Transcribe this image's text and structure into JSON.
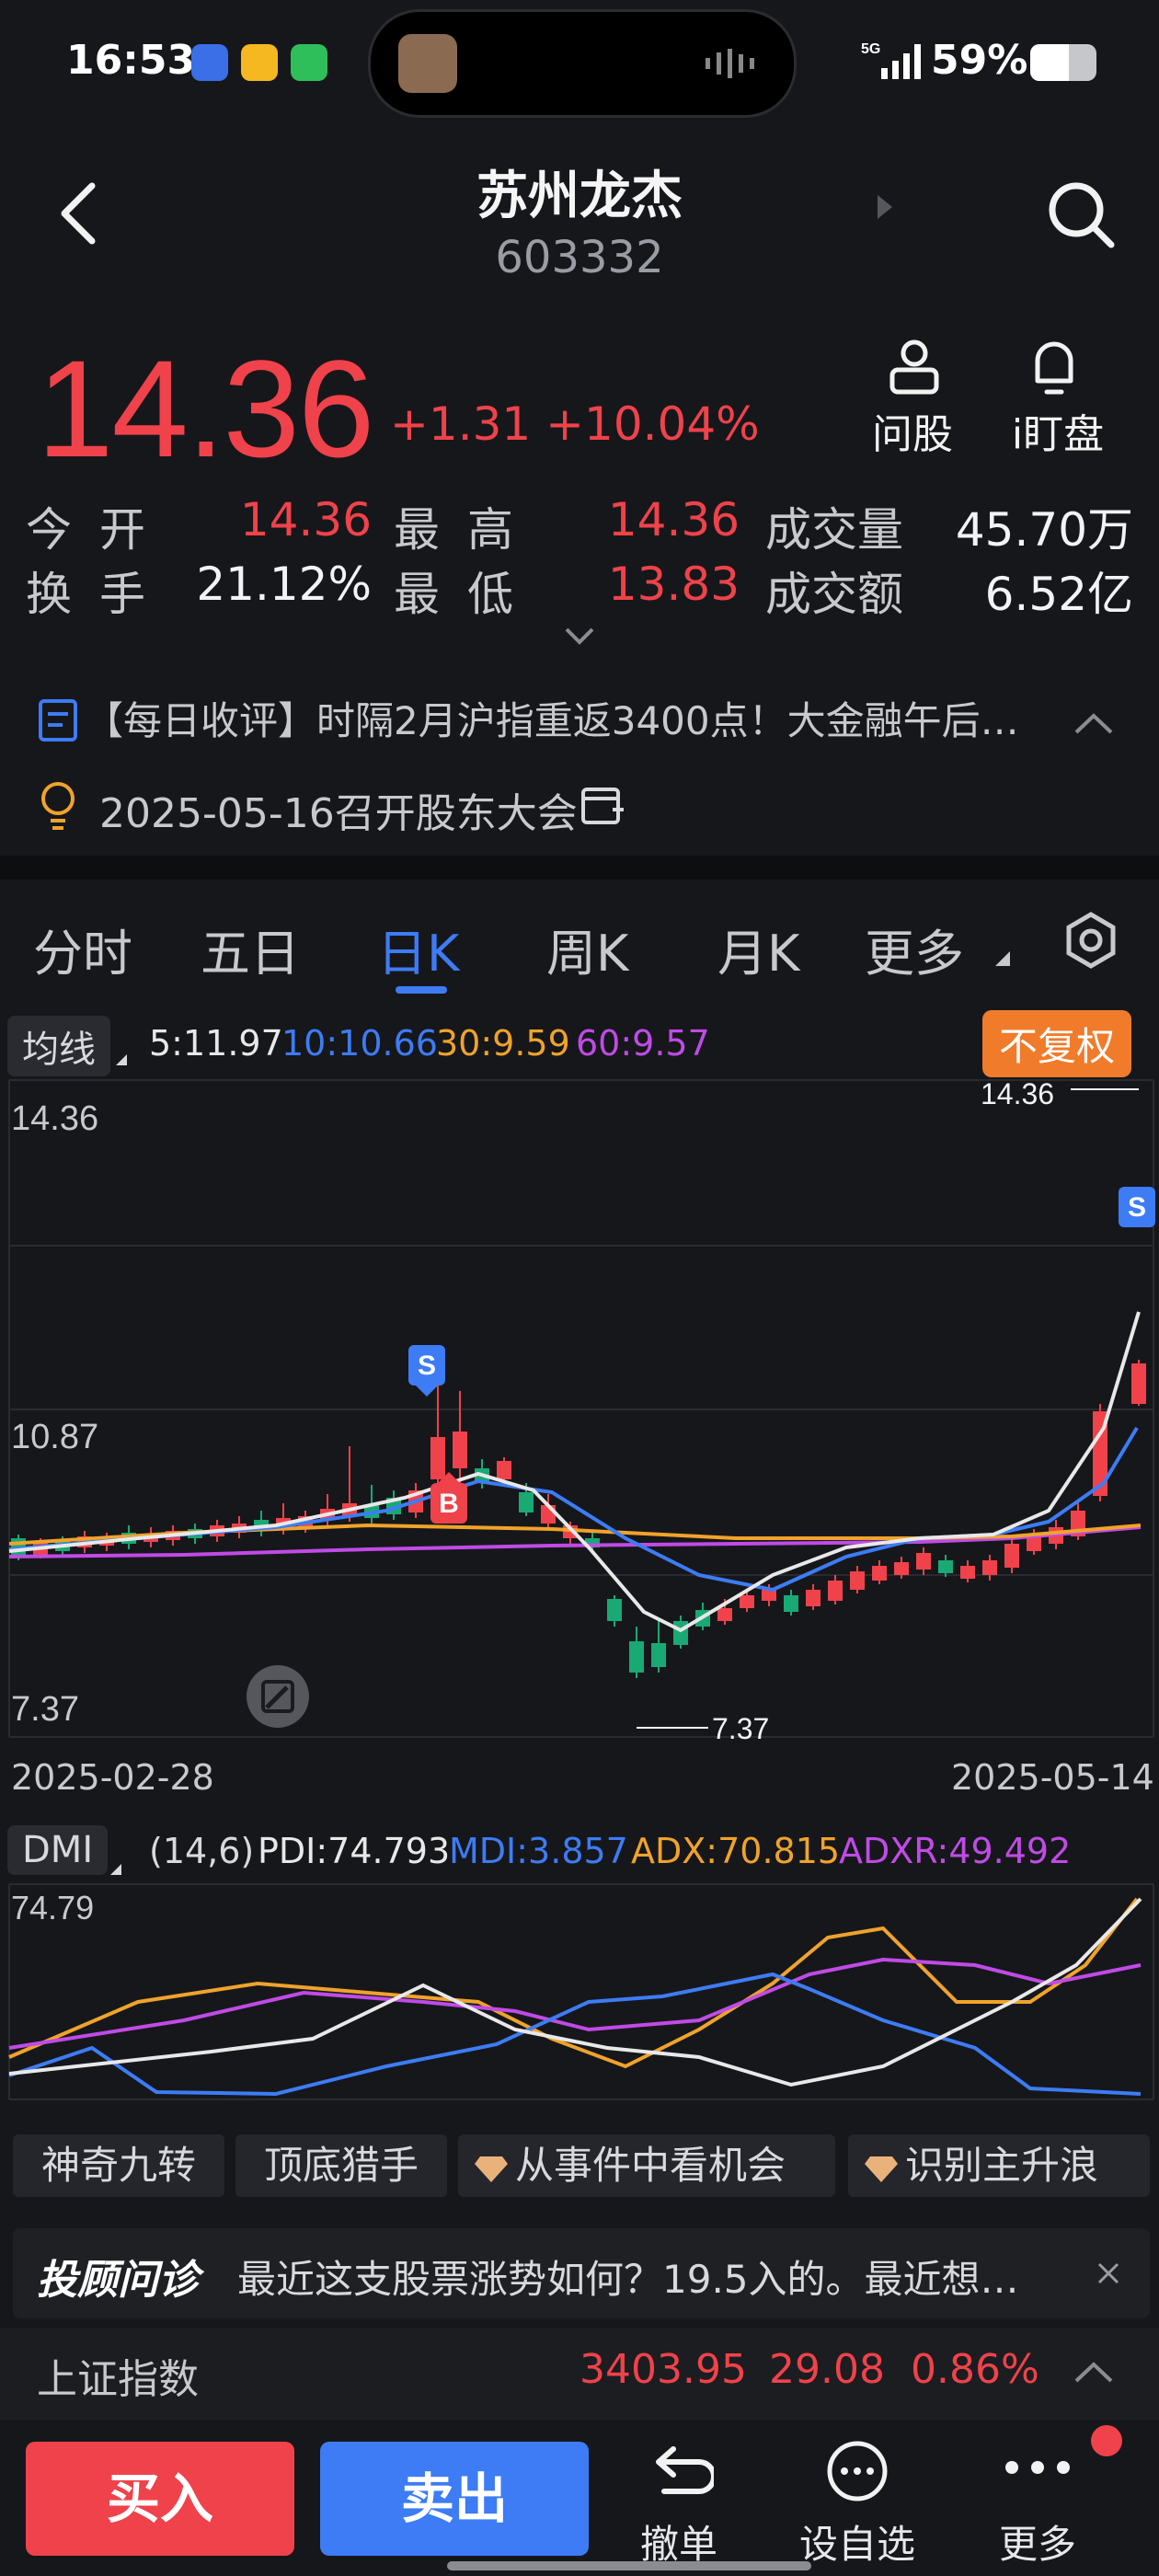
{
  "status_bar": {
    "time": "16:53",
    "network": "5G",
    "battery": "59%",
    "battery_level": 0.59
  },
  "header": {
    "stock_name": "苏州龙杰",
    "stock_code": "603332"
  },
  "quote": {
    "price": "14.36",
    "change": "+1.31",
    "change_pct": "+10.04%",
    "ask_label": "问股",
    "watch_label": "i盯盘",
    "stats": [
      {
        "label": "今开",
        "value": "14.36"
      },
      {
        "label": "最高",
        "value": "14.36"
      },
      {
        "label": "成交量",
        "value": "45.70万"
      },
      {
        "label": "换手",
        "value": "21.12%"
      },
      {
        "label": "最低",
        "value": "13.83"
      },
      {
        "label": "成交额",
        "value": "6.52亿"
      }
    ]
  },
  "news": {
    "headline": "【每日收评】时隔2月沪指重返3400点！大金融午后…",
    "event": "2025-05-16召开股东大会"
  },
  "chart_tabs": [
    "分时",
    "五日",
    "日K",
    "周K",
    "月K",
    "更多"
  ],
  "active_tab": "日K",
  "ma": {
    "selector": "均线",
    "ma5": "5:11.97",
    "ma10": "10:10.66",
    "ma30": "30:9.59",
    "ma60": "60:9.57",
    "adjust": "不复权"
  },
  "kline": {
    "high_label": "14.36",
    "mid_label": "10.87",
    "low_label": "7.37",
    "max_marker": "14.36",
    "min_marker": "7.37",
    "start_date": "2025-02-28",
    "end_date": "2025-05-14",
    "buy_marker": "B",
    "sell_marker": "S"
  },
  "dmi": {
    "selector": "DMI",
    "params": "(14,6)",
    "pdi": "PDI:74.793",
    "mdi": "MDI:3.857",
    "adx": "ADX:70.815",
    "adxr": "ADXR:49.492",
    "top_label": "74.79"
  },
  "tools": [
    "神奇九转",
    "顶底猎手",
    "从事件中看机会",
    "识别主升浪"
  ],
  "banner": {
    "brand": "投顾问诊",
    "text": "最近这支股票涨势如何？19.5入的。最近想…"
  },
  "index_row": {
    "name": "上证指数",
    "value": "3403.95",
    "change": "29.08",
    "pct": "0.86%"
  },
  "bottom_nav": {
    "buy": "买入",
    "sell": "卖出",
    "cancel": "撤单",
    "watchlist": "设自选",
    "more": "更多"
  },
  "colors": {
    "up": "#f0424a",
    "down": "#19a974",
    "accent": "#3d7cf5",
    "ma5": "#e8e8e8",
    "ma10": "#3d7cf5",
    "ma30": "#f0a32a",
    "ma60": "#c04be6"
  }
}
